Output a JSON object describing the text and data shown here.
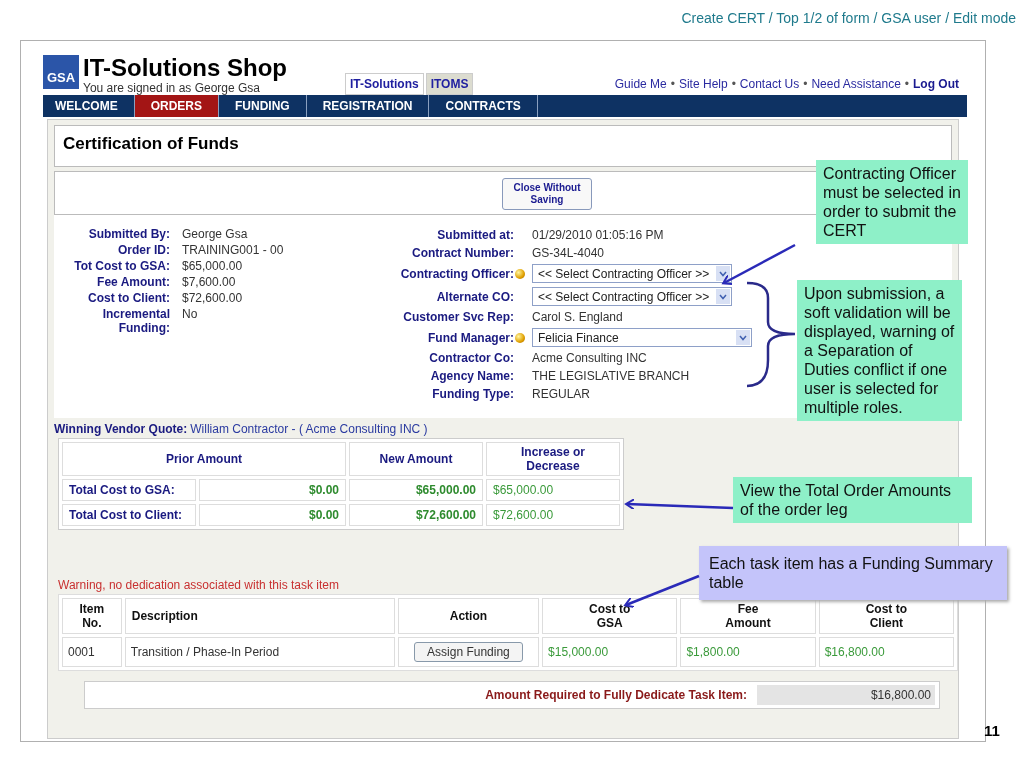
{
  "slide": {
    "caption": "Create CERT / Top 1/2 of form / GSA user / Edit mode",
    "page_number": "11"
  },
  "header": {
    "logo": "GSA",
    "title": "IT-Solutions Shop",
    "signed_in": "You are signed in as George Gsa",
    "link_separator": "•",
    "tabs": [
      {
        "label": "IT-Solutions",
        "selected": true
      },
      {
        "label": "ITOMS",
        "selected": false
      }
    ],
    "links": [
      {
        "label": "Guide Me",
        "emphasis": false
      },
      {
        "label": "Site Help",
        "emphasis": false
      },
      {
        "label": "Contact Us",
        "emphasis": false
      },
      {
        "label": "Need Assistance",
        "emphasis": false
      },
      {
        "label": "Log Out",
        "emphasis": true
      }
    ]
  },
  "nav": [
    {
      "label": "WELCOME",
      "selected": false
    },
    {
      "label": "ORDERS",
      "selected": true
    },
    {
      "label": "FUNDING",
      "selected": false
    },
    {
      "label": "REGISTRATION",
      "selected": false
    },
    {
      "label": "CONTRACTS",
      "selected": false
    }
  ],
  "page_title": "Certification of Funds",
  "close_button": "Close Without\nSaving",
  "fields_left": [
    {
      "label": "Submitted By:",
      "value": "George Gsa"
    },
    {
      "label": "Order ID:",
      "value": "TRAINING001 - 00"
    },
    {
      "label": "Tot Cost to GSA:",
      "value": "$65,000.00"
    },
    {
      "label": "Fee Amount:",
      "value": "$7,600.00"
    },
    {
      "label": "Cost to Client:",
      "value": "$72,600.00"
    },
    {
      "label": "Incremental\nFunding:",
      "value": "No"
    }
  ],
  "fields_right": [
    {
      "label": "Submitted at:",
      "value": "01/29/2010 01:05:16 PM",
      "kind": "text",
      "required": false
    },
    {
      "label": "Contract Number:",
      "value": "GS-34L-4040",
      "kind": "text",
      "required": false
    },
    {
      "label": "Contracting Officer:",
      "value": "<< Select Contracting Officer >>",
      "kind": "select",
      "required": true
    },
    {
      "label": "Alternate CO:",
      "value": "<< Select Contracting Officer >>",
      "kind": "select",
      "required": false
    },
    {
      "label": "Customer Svc Rep:",
      "value": "Carol S. England",
      "kind": "text",
      "required": false
    },
    {
      "label": "Fund Manager:",
      "value": "Felicia Finance",
      "kind": "wide-select",
      "required": true
    },
    {
      "label": "Contractor Co:",
      "value": "Acme Consulting INC",
      "kind": "text",
      "required": false
    },
    {
      "label": "Agency Name:",
      "value": "THE LEGISLATIVE BRANCH",
      "kind": "text",
      "required": false
    },
    {
      "label": "Funding Type:",
      "value": "REGULAR",
      "kind": "text",
      "required": false
    }
  ],
  "vendor_quote": {
    "label": "Winning Vendor Quote:",
    "value": "William Contractor - ( Acme Consulting INC )"
  },
  "totals_table": {
    "columns": [
      "Prior Amount",
      "New Amount",
      "Increase or Decrease"
    ],
    "rows": [
      {
        "label": "Total Cost to GSA:",
        "prior": "$0.00",
        "new": "$65,000.00",
        "change": "$65,000.00"
      },
      {
        "label": "Total Cost to Client:",
        "prior": "$0.00",
        "new": "$72,600.00",
        "change": "$72,600.00"
      }
    ]
  },
  "warning": "Warning, no dedication associated with this task item",
  "task_table": {
    "columns": [
      "Item\nNo.",
      "Description",
      "Action",
      "Cost to\nGSA",
      "Fee\nAmount",
      "Cost to\nClient"
    ],
    "rows": [
      {
        "item": "0001",
        "description": "Transition / Phase-In Period",
        "action": "Assign Funding",
        "cost_gsa": "$15,000.00",
        "fee": "$1,800.00",
        "cost_client": "$16,800.00"
      }
    ]
  },
  "amount_required": {
    "label": "Amount Required to Fully Dedicate Task Item:",
    "value": "$16,800.00"
  },
  "callouts": [
    {
      "text": "Contracting Officer must be selected in order to submit the CERT",
      "color": "#8ef0c8"
    },
    {
      "text": "Upon submission, a soft validation will be displayed, warning of a Separation of Duties conflict if one user is selected for multiple roles.",
      "color": "#8ef0c8"
    },
    {
      "text": "View the Total Order Amounts of the order leg",
      "color": "#8ef0c8"
    },
    {
      "text": "Each task item has a Funding Summary table",
      "color": "#c4c4fa"
    }
  ]
}
